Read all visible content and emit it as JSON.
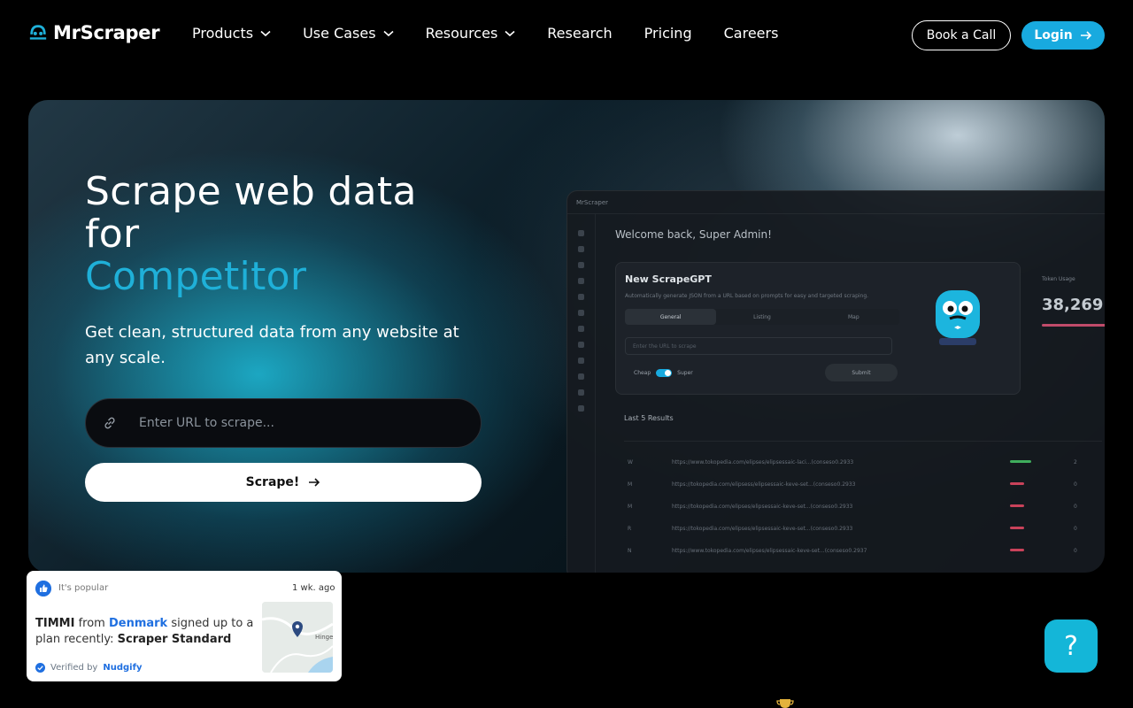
{
  "brand": {
    "name": "MrScraper",
    "accent": "#18aadf"
  },
  "nav": {
    "links": [
      {
        "label": "Products",
        "dropdown": true
      },
      {
        "label": "Use Cases",
        "dropdown": true
      },
      {
        "label": "Resources",
        "dropdown": true
      },
      {
        "label": "Research",
        "dropdown": false
      },
      {
        "label": "Pricing",
        "dropdown": false
      },
      {
        "label": "Careers",
        "dropdown": false
      }
    ],
    "book_call": "Book a Call",
    "login": "Login"
  },
  "hero": {
    "title_line1": "Scrape web data",
    "title_line2": "for",
    "title_accent": "Competitor",
    "subtitle": "Get clean, structured data from any website at any scale.",
    "url_placeholder": "Enter URL to scrape...",
    "scrape_button": "Scrape!"
  },
  "dashboard": {
    "app_name": "MrScraper",
    "welcome": "Welcome back, Super Admin!",
    "card_title": "New ScrapeGPT",
    "card_desc": "Automatically generate JSON from a URL based on prompts for easy and targeted scraping.",
    "tabs": [
      "General",
      "Listing",
      "Map"
    ],
    "input_placeholder": "Enter the URL to scrape",
    "toggle_left": "Cheap",
    "toggle_right": "Super",
    "submit": "Submit",
    "usage_label": "Token Usage",
    "usage_value": "38,269",
    "results_title": "Last 5 Results",
    "results": [
      {
        "id": "W",
        "url": "https://www.tokopedia.com/elipses/elipsessaic-laci...(conseso0.2933",
        "status": "success",
        "count": "2"
      },
      {
        "id": "M",
        "url": "https://tokopedia.com/elipsess/elipsessaic-keve-set...(conseso0.2933",
        "status": "fail",
        "count": "0"
      },
      {
        "id": "M",
        "url": "https://tokopedia.com/elipses/elipsessaic-keve-set...(conseso0.2933",
        "status": "fail",
        "count": "0"
      },
      {
        "id": "R",
        "url": "https://tokopedia.com/elipses/elipsessaic-keve-set...(conseso0.2933",
        "status": "fail",
        "count": "0"
      },
      {
        "id": "N",
        "url": "https://www.tokopedia.com/elipses/elipsessaic-keve-set...(conseso0.2937",
        "status": "fail",
        "count": "0"
      }
    ]
  },
  "popup": {
    "label": "It's popular",
    "time": "1 wk. ago",
    "name": "TIMMI",
    "from": "from",
    "country": "Denmark",
    "action": "signed up to a plan recently:",
    "plan": "Scraper Standard",
    "verified_prefix": "Verified by",
    "verified_by": "Nudgify",
    "map_label": "Hinge"
  },
  "help": {
    "label": "?"
  }
}
